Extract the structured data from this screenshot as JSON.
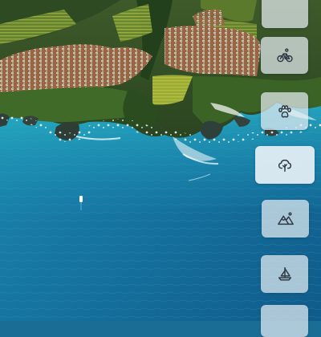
{
  "rail": {
    "items": [
      {
        "icon": "blank-icon"
      },
      {
        "icon": "cyclist-icon"
      },
      {
        "icon": "paw-icon"
      },
      {
        "icon": "tree-icon",
        "active": true
      },
      {
        "icon": "mountain-icon"
      },
      {
        "icon": "sailboat-icon"
      },
      {
        "icon": "blank-icon"
      }
    ]
  },
  "colors": {
    "icon_stroke": "#2f3a44",
    "button_bg": "#e5edf3"
  }
}
